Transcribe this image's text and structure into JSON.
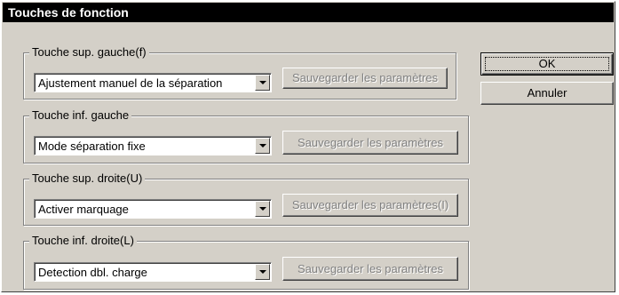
{
  "window": {
    "title": "Touches de fonction"
  },
  "groups": [
    {
      "label": "Touche sup. gauche(f)",
      "combo_value": "Ajustement manuel de la séparation",
      "save_label": "Sauvegarder les paramètres"
    },
    {
      "label": "Touche inf. gauche",
      "combo_value": "Mode séparation fixe",
      "save_label": "Sauvegarder les paramètres"
    },
    {
      "label": "Touche sup. droite(U)",
      "combo_value": "Activer marquage",
      "save_label": "Sauvegarder les paramètres(I)"
    },
    {
      "label": "Touche inf. droite(L)",
      "combo_value": "Detection dbl. charge",
      "save_label": "Sauvegarder les paramètres"
    }
  ],
  "buttons": {
    "ok_label": "OK",
    "cancel_label": "Annuler"
  }
}
